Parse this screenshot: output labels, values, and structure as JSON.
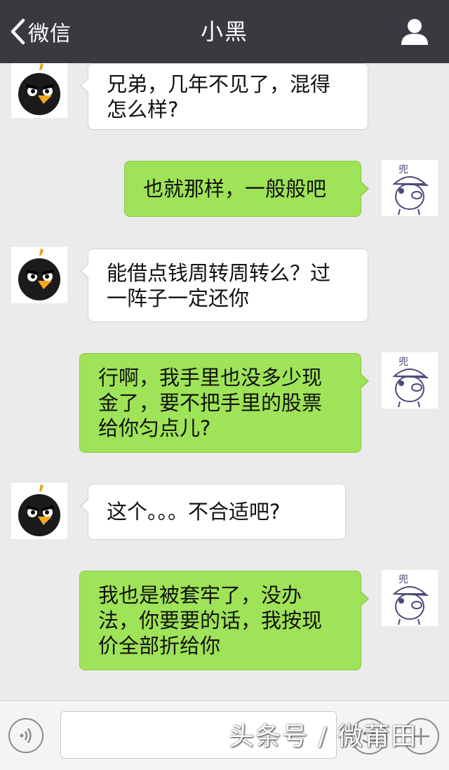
{
  "header": {
    "back_label": "微信",
    "title": "小黑"
  },
  "messages": [
    {
      "side": "left",
      "sender": "bird",
      "lines": [
        "兄弟，几年不见了，混得",
        "怎么样?"
      ]
    },
    {
      "side": "right",
      "sender": "pig",
      "lines": [
        "也就那样，一般般吧"
      ]
    },
    {
      "side": "left",
      "sender": "bird",
      "lines": [
        "能借点钱周转周转么？过",
        "一阵子一定还你"
      ]
    },
    {
      "side": "right",
      "sender": "pig",
      "lines": [
        "行啊，我手里也没多少现",
        "金了，要不把手里的股票",
        "给你匀点儿?"
      ]
    },
    {
      "side": "left",
      "sender": "bird",
      "lines": [
        "这个。。。不合适吧?"
      ]
    },
    {
      "side": "right",
      "sender": "pig",
      "lines": [
        "我也是被套牢了，没办",
        "法，你要要的话，我按现",
        "价全部折给你"
      ]
    }
  ],
  "colors": {
    "header_bg": "#393a3f",
    "chat_bg": "#ebebeb",
    "incoming_bubble": "#ffffff",
    "outgoing_bubble": "#9fe358"
  },
  "icons": {
    "back": "chevron-left-icon",
    "profile": "person-icon",
    "voice": "voice-icon",
    "emoji": "emoji-icon",
    "more": "plus-icon"
  },
  "avatar_labels": {
    "pig": "兜"
  },
  "watermark": "头条号 / 微莆田"
}
